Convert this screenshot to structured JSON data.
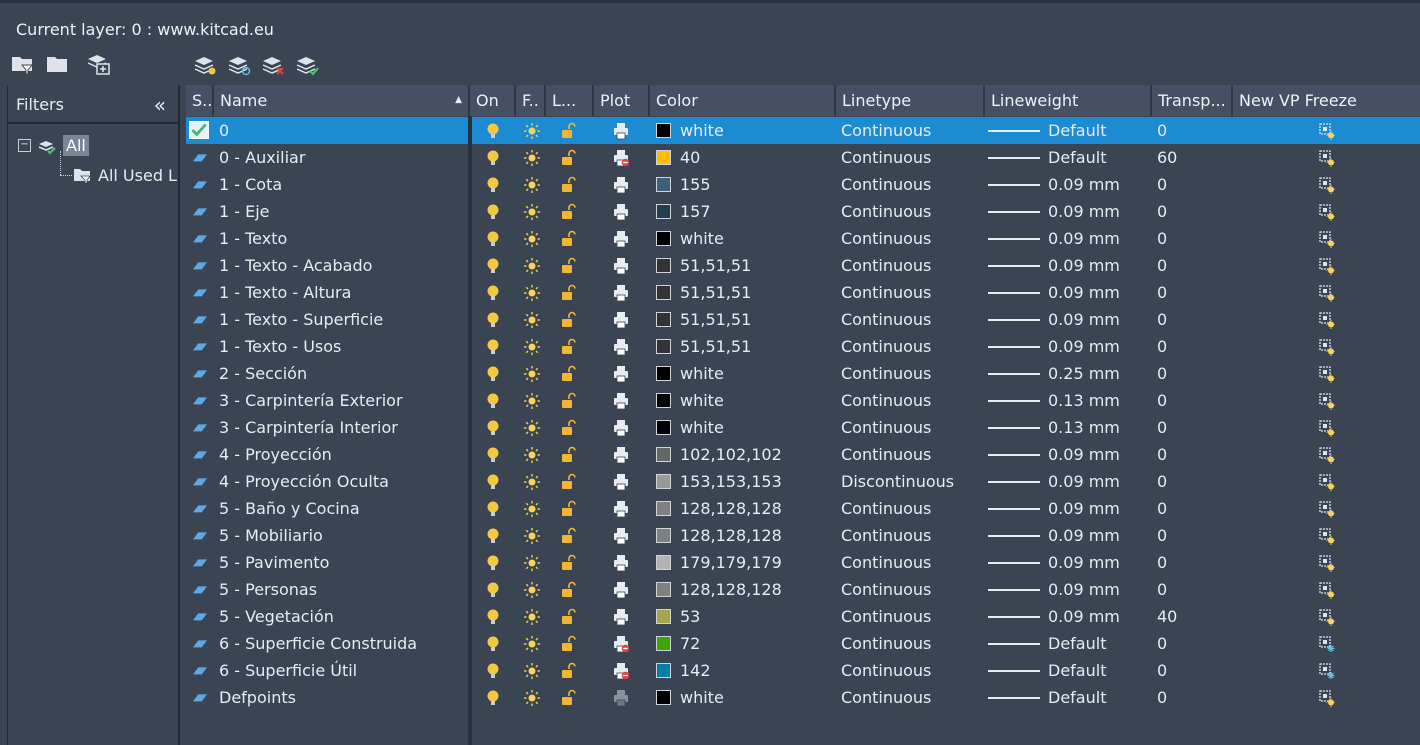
{
  "current_layer": "Current layer: 0 : www.kitcad.eu",
  "filters": {
    "title": "Filters",
    "all": "All",
    "all_used": "All Used Layers"
  },
  "columns": {
    "status": "S..",
    "name": "Name",
    "on": "On",
    "freeze": "F..",
    "lock": "L...",
    "plot": "Plot",
    "color": "Color",
    "linetype": "Linetype",
    "lineweight": "Lineweight",
    "transparency": "Transp...",
    "vp_freeze": "New VP Freeze"
  },
  "colors": {
    "accent": "#1d8bd1",
    "bulb": "#f5c842",
    "sun": "#f7d35a",
    "lock": "#f2b632",
    "printer_stop": "#e04040"
  },
  "layers": [
    {
      "name": "0",
      "color": "white",
      "swatch": "#000000",
      "linetype": "Continuous",
      "lineweight": "Default",
      "transparency": "0",
      "current": true,
      "noplot": false,
      "vpstyle": "normal",
      "plot_disabled": false
    },
    {
      "name": "0 - Auxiliar",
      "color": "40",
      "swatch": "#ffbf00",
      "linetype": "Continuous",
      "lineweight": "Default",
      "transparency": "60",
      "current": false,
      "noplot": true,
      "vpstyle": "normal",
      "plot_disabled": false
    },
    {
      "name": "1 - Cota",
      "color": "155",
      "swatch": "#3f5f7f",
      "linetype": "Continuous",
      "lineweight": "0.09 mm",
      "transparency": "0",
      "current": false,
      "noplot": false,
      "vpstyle": "normal",
      "plot_disabled": false
    },
    {
      "name": "1 - Eje",
      "color": "157",
      "swatch": "#263f4c",
      "linetype": "Continuous",
      "lineweight": "0.09 mm",
      "transparency": "0",
      "current": false,
      "noplot": false,
      "vpstyle": "normal",
      "plot_disabled": false
    },
    {
      "name": "1 - Texto",
      "color": "white",
      "swatch": "#000000",
      "linetype": "Continuous",
      "lineweight": "0.09 mm",
      "transparency": "0",
      "current": false,
      "noplot": false,
      "vpstyle": "normal",
      "plot_disabled": false
    },
    {
      "name": "1 - Texto - Acabado",
      "color": "51,51,51",
      "swatch": "#333333",
      "linetype": "Continuous",
      "lineweight": "0.09 mm",
      "transparency": "0",
      "current": false,
      "noplot": false,
      "vpstyle": "normal",
      "plot_disabled": false
    },
    {
      "name": "1 - Texto - Altura",
      "color": "51,51,51",
      "swatch": "#333333",
      "linetype": "Continuous",
      "lineweight": "0.09 mm",
      "transparency": "0",
      "current": false,
      "noplot": false,
      "vpstyle": "normal",
      "plot_disabled": false
    },
    {
      "name": "1 - Texto - Superficie",
      "color": "51,51,51",
      "swatch": "#333333",
      "linetype": "Continuous",
      "lineweight": "0.09 mm",
      "transparency": "0",
      "current": false,
      "noplot": false,
      "vpstyle": "normal",
      "plot_disabled": false
    },
    {
      "name": "1 - Texto - Usos",
      "color": "51,51,51",
      "swatch": "#333333",
      "linetype": "Continuous",
      "lineweight": "0.09 mm",
      "transparency": "0",
      "current": false,
      "noplot": false,
      "vpstyle": "normal",
      "plot_disabled": false
    },
    {
      "name": "2 - Sección",
      "color": "white",
      "swatch": "#000000",
      "linetype": "Continuous",
      "lineweight": "0.25 mm",
      "transparency": "0",
      "current": false,
      "noplot": false,
      "vpstyle": "normal",
      "plot_disabled": false
    },
    {
      "name": "3 - Carpintería Exterior",
      "color": "white",
      "swatch": "#000000",
      "linetype": "Continuous",
      "lineweight": "0.13 mm",
      "transparency": "0",
      "current": false,
      "noplot": false,
      "vpstyle": "normal",
      "plot_disabled": false
    },
    {
      "name": "3 - Carpintería Interior",
      "color": "white",
      "swatch": "#000000",
      "linetype": "Continuous",
      "lineweight": "0.13 mm",
      "transparency": "0",
      "current": false,
      "noplot": false,
      "vpstyle": "normal",
      "plot_disabled": false
    },
    {
      "name": "4 - Proyección",
      "color": "102,102,102",
      "swatch": "#666666",
      "linetype": "Continuous",
      "lineweight": "0.09 mm",
      "transparency": "0",
      "current": false,
      "noplot": false,
      "vpstyle": "normal",
      "plot_disabled": false
    },
    {
      "name": "4 - Proyección Oculta",
      "color": "153,153,153",
      "swatch": "#999999",
      "linetype": "Discontinuous",
      "lineweight": "0.09 mm",
      "transparency": "0",
      "current": false,
      "noplot": false,
      "vpstyle": "normal",
      "plot_disabled": false
    },
    {
      "name": "5 - Baño y Cocina",
      "color": "128,128,128",
      "swatch": "#808080",
      "linetype": "Continuous",
      "lineweight": "0.09 mm",
      "transparency": "0",
      "current": false,
      "noplot": false,
      "vpstyle": "normal",
      "plot_disabled": false
    },
    {
      "name": "5 - Mobiliario",
      "color": "128,128,128",
      "swatch": "#808080",
      "linetype": "Continuous",
      "lineweight": "0.09 mm",
      "transparency": "0",
      "current": false,
      "noplot": false,
      "vpstyle": "normal",
      "plot_disabled": false
    },
    {
      "name": "5 - Pavimento",
      "color": "179,179,179",
      "swatch": "#b3b3b3",
      "linetype": "Continuous",
      "lineweight": "0.09 mm",
      "transparency": "0",
      "current": false,
      "noplot": false,
      "vpstyle": "normal",
      "plot_disabled": false
    },
    {
      "name": "5 - Personas",
      "color": "128,128,128",
      "swatch": "#808080",
      "linetype": "Continuous",
      "lineweight": "0.09 mm",
      "transparency": "0",
      "current": false,
      "noplot": false,
      "vpstyle": "normal",
      "plot_disabled": false
    },
    {
      "name": "5 - Vegetación",
      "color": "53",
      "swatch": "#a5a54c",
      "linetype": "Continuous",
      "lineweight": "0.09 mm",
      "transparency": "40",
      "current": false,
      "noplot": false,
      "vpstyle": "normal",
      "plot_disabled": false
    },
    {
      "name": "6 - Superficie Construida",
      "color": "72",
      "swatch": "#3fa500",
      "linetype": "Continuous",
      "lineweight": "Default",
      "transparency": "0",
      "current": false,
      "noplot": true,
      "vpstyle": "frozen",
      "plot_disabled": false
    },
    {
      "name": "6 - Superficie Útil",
      "color": "142",
      "swatch": "#007fa5",
      "linetype": "Continuous",
      "lineweight": "Default",
      "transparency": "0",
      "current": false,
      "noplot": true,
      "vpstyle": "frozen",
      "plot_disabled": false
    },
    {
      "name": "Defpoints",
      "color": "white",
      "swatch": "#000000",
      "linetype": "Continuous",
      "lineweight": "Default",
      "transparency": "0",
      "current": false,
      "noplot": false,
      "vpstyle": "normal",
      "plot_disabled": true
    }
  ]
}
